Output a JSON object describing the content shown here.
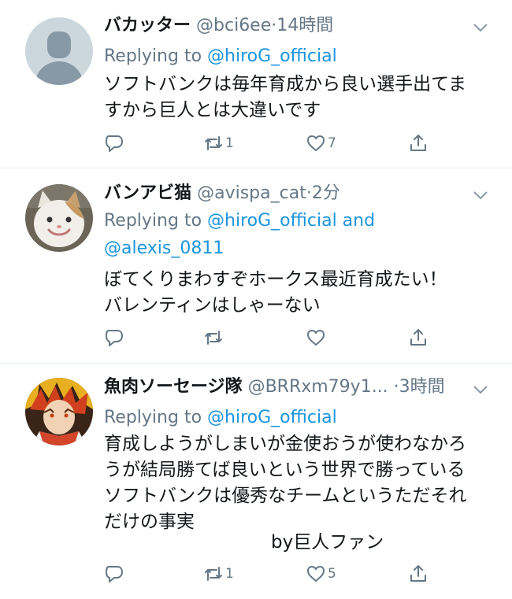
{
  "tweets": [
    {
      "name": "バカッター",
      "handle": "@bci6ee",
      "sep": "·",
      "time": "14時間",
      "replying_prefix": "Replying to ",
      "replying_to": "@hiroG_official",
      "replying_and": "",
      "replying_to2": "",
      "text": "ソフトバンクは毎年育成から良い選手出てま\nすから巨人とは大違いです",
      "retweets": "1",
      "likes": "7"
    },
    {
      "name": "バンアビ猫",
      "handle": "@avispa_cat",
      "sep": "·",
      "time": "2分",
      "replying_prefix": "Replying to ",
      "replying_to": "@hiroG_official",
      "replying_and": " and",
      "replying_to2": "@alexis_0811",
      "text": "ぼてくりまわすぞホークス最近育成たい！\nバレンティンはしゃーない",
      "retweets": "",
      "likes": ""
    },
    {
      "name": "魚肉ソーセージ隊",
      "handle": "@BRRxm79y1...",
      "sep": "·",
      "time": "3時間",
      "replying_prefix": "Replying to ",
      "replying_to": "@hiroG_official",
      "replying_and": "",
      "replying_to2": "",
      "text": "育成しようがしまいが金使おうが使わなかろ\nうが結局勝てば良いという世界で勝っている\nソフトバンクは優秀なチームというただそれ\nだけの事実",
      "signature": "by巨人ファン",
      "retweets": "1",
      "likes": "5"
    }
  ],
  "colors": {
    "accent": "#1b95e0",
    "muted": "#657786",
    "divider": "#e6ecf0"
  },
  "icons": [
    "reply-icon",
    "retweet-icon",
    "like-icon",
    "share-icon",
    "chevron-down-icon"
  ]
}
